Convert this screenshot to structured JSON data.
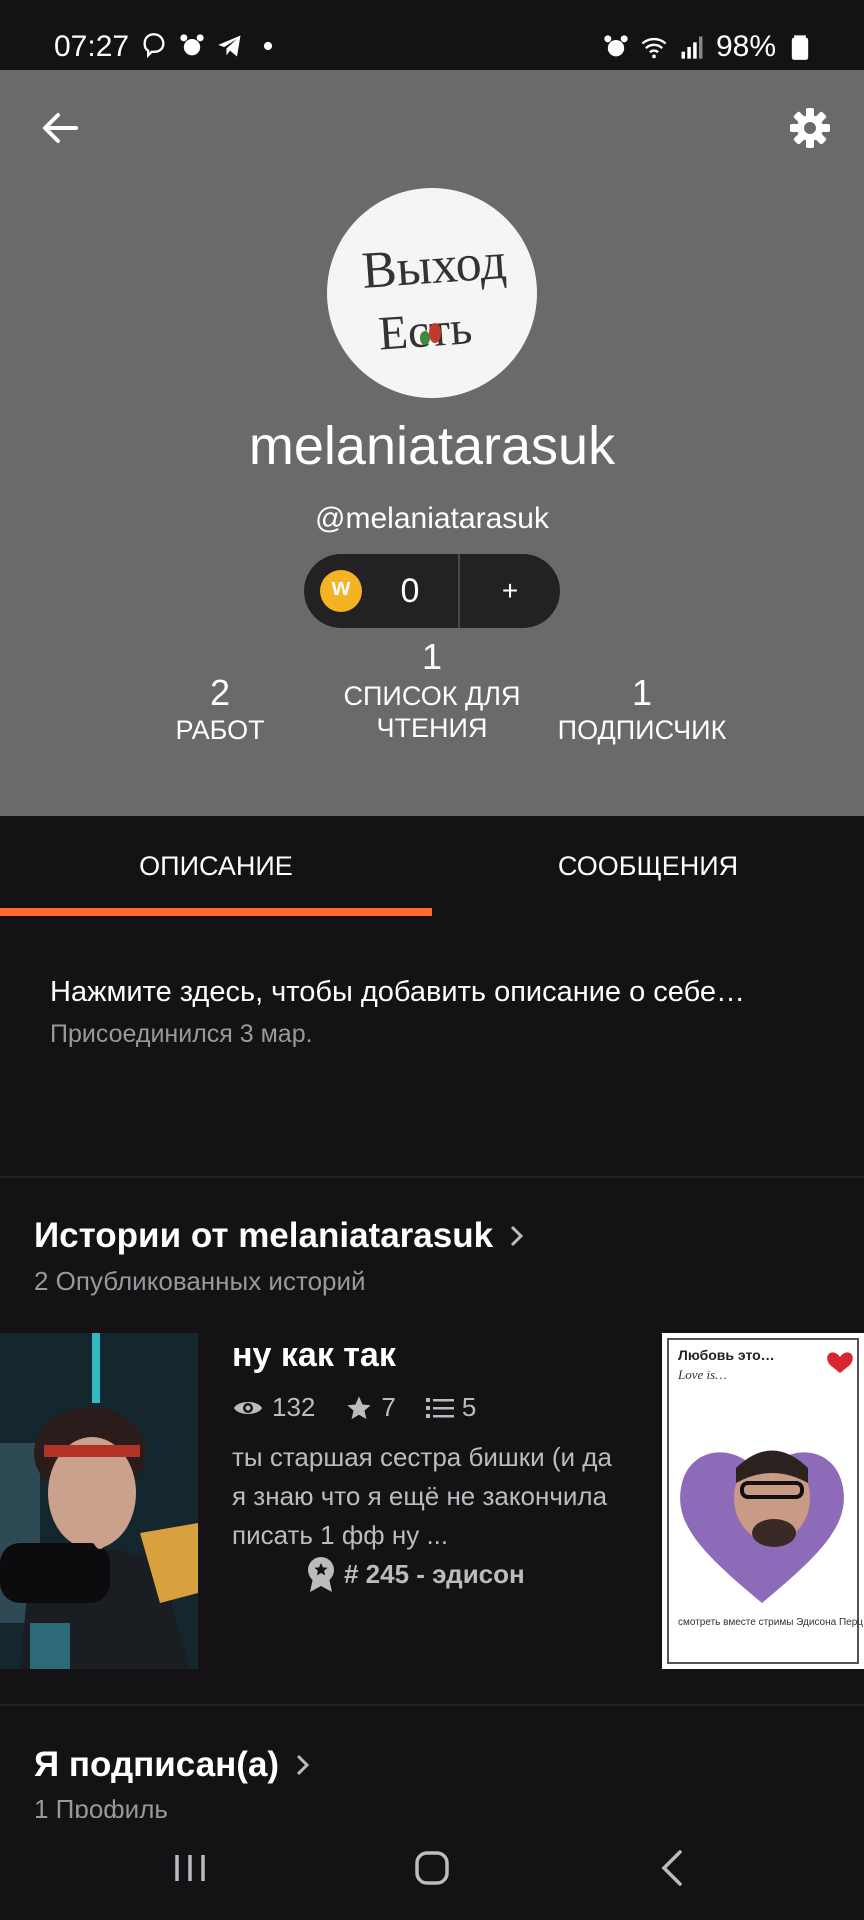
{
  "status_bar": {
    "time": "07:27",
    "battery": "98%",
    "left_icons": [
      "viber-icon",
      "alarm-icon",
      "telegram-icon",
      "dot-icon"
    ],
    "right_icons": [
      "alarm-icon",
      "wifi-icon",
      "signal-icon",
      "battery-icon"
    ]
  },
  "header": {
    "username": "melaniatarasuk",
    "handle": "@melaniatarasuk",
    "coins": "0",
    "coins_add": "+",
    "avatar_text": "Выход Есть",
    "background_color": "#6a696b"
  },
  "stats": [
    {
      "value": "2",
      "label": "РАБОТ"
    },
    {
      "value": "1",
      "label": "СПИСОК ДЛЯ ЧТЕНИЯ"
    },
    {
      "value": "1",
      "label": "ПОДПИСЧИК"
    }
  ],
  "tabs": [
    {
      "label": "ОПИСАНИЕ",
      "active": true
    },
    {
      "label": "СООБЩЕНИЯ",
      "active": false
    }
  ],
  "accent_color": "#ff6b2d",
  "about": {
    "prompt": "Нажмите здесь, чтобы добавить описание о себе…",
    "joined": "Присоединился 3 мар."
  },
  "stories_section": {
    "title": "Истории от melaniatarasuk",
    "subtitle": "2 Опубликованных историй",
    "story": {
      "title": "ну как так",
      "views": "132",
      "votes": "7",
      "parts": "5",
      "description": "ты старшая сестра бишки (и да я знаю что я ещё не закончила писать 1 фф ну ...",
      "rank": "# 245 - эдисон"
    },
    "second_cover": {
      "title": "Любовь это…",
      "subtitle": "Love is…",
      "caption": "смотреть вместе стримы Эдисона Перц"
    }
  },
  "following_section": {
    "title": "Я подписан(а)",
    "subtitle": "1 Профиль"
  }
}
